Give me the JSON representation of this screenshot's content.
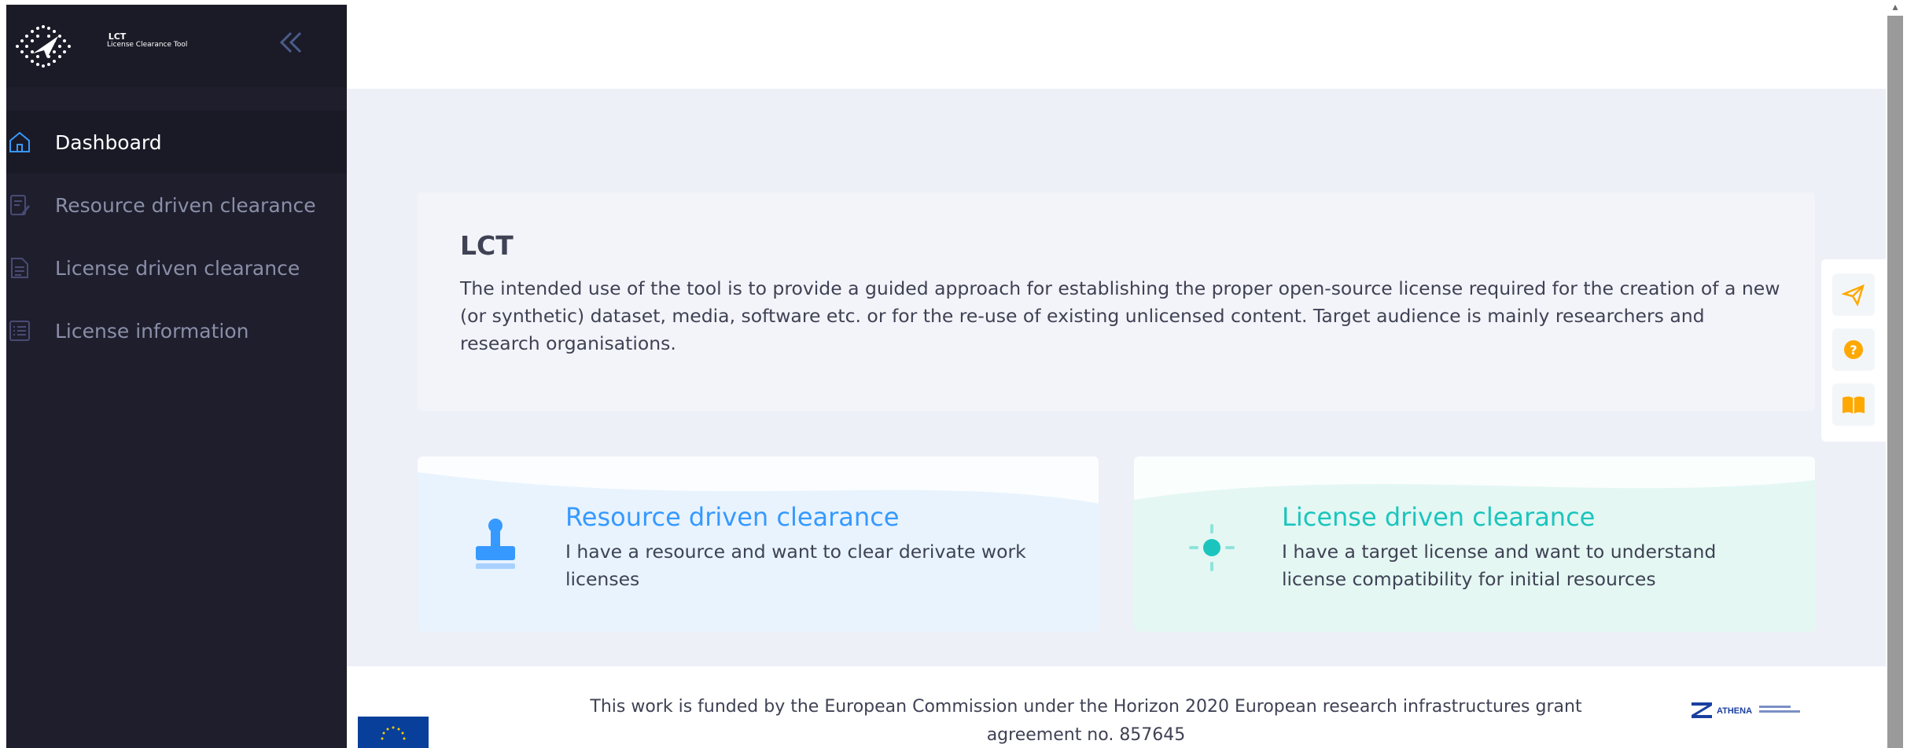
{
  "app": {
    "logo_title": "LCT",
    "logo_subtitle": "License Clearance Tool"
  },
  "sidebar": {
    "items": [
      {
        "label": "Dashboard",
        "icon": "home-icon",
        "active": true
      },
      {
        "label": "Resource driven clearance",
        "icon": "document-edit-icon",
        "active": false
      },
      {
        "label": "License driven clearance",
        "icon": "document-icon",
        "active": false
      },
      {
        "label": "License information",
        "icon": "list-icon",
        "active": false
      }
    ]
  },
  "intro": {
    "title": "LCT",
    "text": "The intended use of the tool is to provide a guided approach for establishing the proper open-source license required for the creation of a new (or synthetic) dataset, media, software etc. or for the re-use of existing unlicensed content. Target audience is mainly researchers and research organisations."
  },
  "cards": [
    {
      "title": "Resource driven clearance",
      "description": "I have a resource and want to clear derivate work licenses",
      "icon": "stamp-icon",
      "color": "#3699ff"
    },
    {
      "title": "License driven clearance",
      "description": "I have a target license and want to understand license compatibility for initial resources",
      "icon": "sun-icon",
      "color": "#1bc5bd"
    }
  ],
  "footer": {
    "text": "This work is funded by the European Commission under the Horizon 2020 European research infrastructures grant agreement no. 857645",
    "partner_logo": "ATHENA"
  },
  "floatbar": {
    "buttons": [
      {
        "icon": "paper-plane-icon"
      },
      {
        "icon": "question-icon"
      },
      {
        "icon": "book-icon"
      }
    ],
    "accent": "#ffa800"
  }
}
